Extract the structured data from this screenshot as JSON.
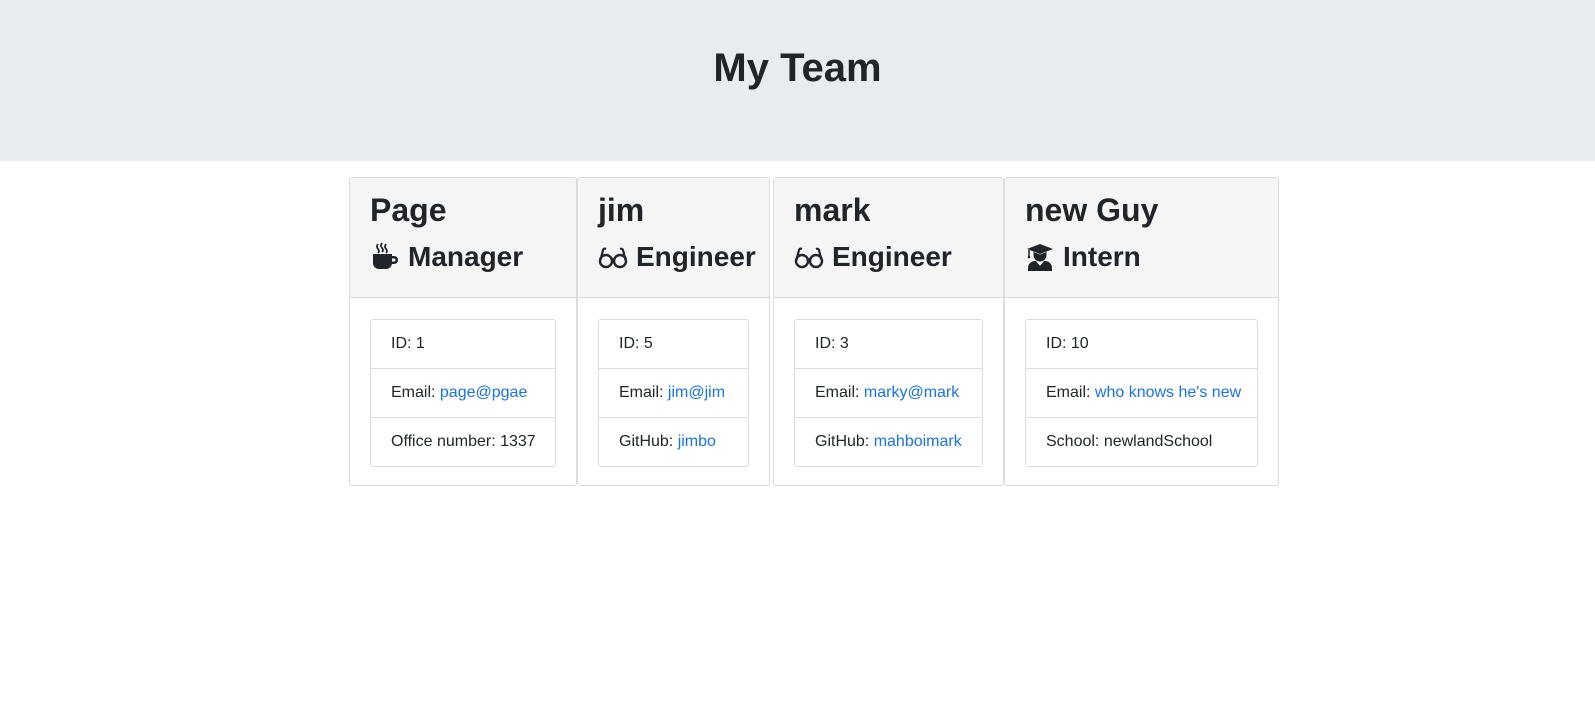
{
  "header": {
    "title": "My Team"
  },
  "cards": [
    {
      "name": "Page",
      "role": "Manager",
      "icon": "coffee-cup-icon",
      "id_text": "ID: 1",
      "email_label": "Email: ",
      "email": "page@pgae",
      "extra_label": "Office number: 1337",
      "extra_link": ""
    },
    {
      "name": "jim",
      "role": "Engineer",
      "icon": "glasses-icon",
      "id_text": "ID: 5",
      "email_label": "Email: ",
      "email": "jim@jim",
      "extra_label": "GitHub: ",
      "extra_link": "jimbo"
    },
    {
      "name": "mark",
      "role": "Engineer",
      "icon": "glasses-icon",
      "id_text": "ID: 3",
      "email_label": "Email: ",
      "email": "marky@mark",
      "extra_label": "GitHub: ",
      "extra_link": "mahboimark"
    },
    {
      "name": "new Guy",
      "role": "Intern",
      "icon": "graduate-icon",
      "id_text": "ID: 10",
      "email_label": "Email: ",
      "email": "who knows he's new",
      "extra_label": "School: newlandSchool",
      "extra_link": ""
    }
  ],
  "colors": {
    "link": "#1a73e8",
    "header_bg": "#e9ecef",
    "card_header_bg": "#f5f5f5"
  }
}
